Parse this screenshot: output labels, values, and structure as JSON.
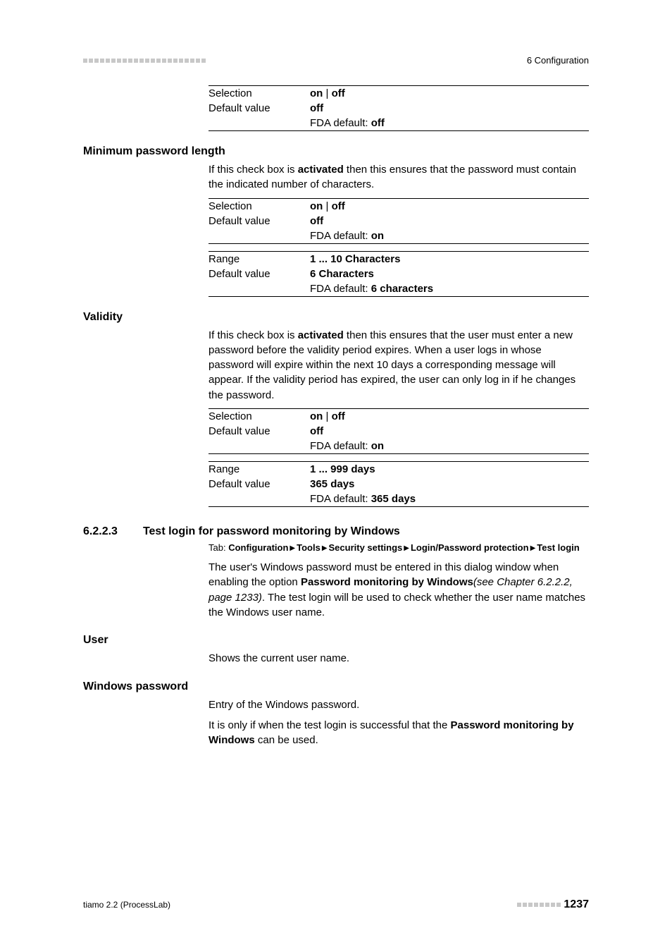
{
  "header": {
    "right": "6 Configuration"
  },
  "top_table": {
    "r1k": "Selection",
    "r1v_pre": "on",
    "r1v_sep": " | ",
    "r1v_bold": "off",
    "r2k": "Default value",
    "r2v_bold": "off",
    "r3pre": "FDA default: ",
    "r3bold": "off"
  },
  "sec1": {
    "title": "Minimum password length",
    "para_pre": "If this check box is ",
    "para_bold": "activated",
    "para_post": " then this ensures that the password must contain the indicated number of characters.",
    "t1": {
      "r1k": "Selection",
      "r1v_pre": "on",
      "r1v_sep": " | ",
      "r1v_bold": "off",
      "r2k": "Default value",
      "r2v_bold": "off",
      "r3pre": "FDA default: ",
      "r3bold": "on"
    },
    "t2": {
      "r1k": "Range",
      "r1v": "1 ... 10 Characters",
      "r2k": "Default value",
      "r2v": "6 Characters",
      "r3pre": "FDA default: ",
      "r3bold": "6 characters"
    }
  },
  "sec2": {
    "title": "Validity",
    "para_pre": "If this check box is ",
    "para_bold": "activated",
    "para_post": " then this ensures that the user must enter a new password before the validity period expires. When a user logs in whose password will expire within the next 10 days a corresponding message will appear. If the validity period has expired, the user can only log in if he changes the password.",
    "t1": {
      "r1k": "Selection",
      "r1v_pre": "on",
      "r1v_sep": " | ",
      "r1v_bold": "off",
      "r2k": "Default value",
      "r2v_bold": "off",
      "r3pre": "FDA default: ",
      "r3bold": "on"
    },
    "t2": {
      "r1k": "Range",
      "r1v": "1 ... 999 days",
      "r2k": "Default value",
      "r2v": "365 days",
      "r3pre": "FDA default: ",
      "r3bold": "365 days"
    }
  },
  "sec3": {
    "num": "6.2.2.3",
    "title": "Test login for password monitoring by Windows",
    "tab_label": "Tab: ",
    "tab_parts": [
      "Configuration",
      "Tools",
      "Security settings",
      "Login/Password protection",
      "Test login"
    ],
    "p1_pre": "The user's Windows password must be entered in this dialog window when enabling the option ",
    "p1_bold": "Password monitoring by Windows",
    "p1_italic": "(see Chapter 6.2.2.2, page 1233)",
    "p1_post": ". The test login will be used to check whether the user name matches the Windows user name.",
    "user_h": "User",
    "user_t": "Shows the current user name.",
    "wp_h": "Windows password",
    "wp_t": "Entry of the Windows password.",
    "wp2_pre": "It is only if when the test login is successful that the ",
    "wp2_bold": "Password monitoring by Windows",
    "wp2_post": " can be used."
  },
  "footer": {
    "left": "tiamo 2.2 (ProcessLab)",
    "right": "1237"
  }
}
